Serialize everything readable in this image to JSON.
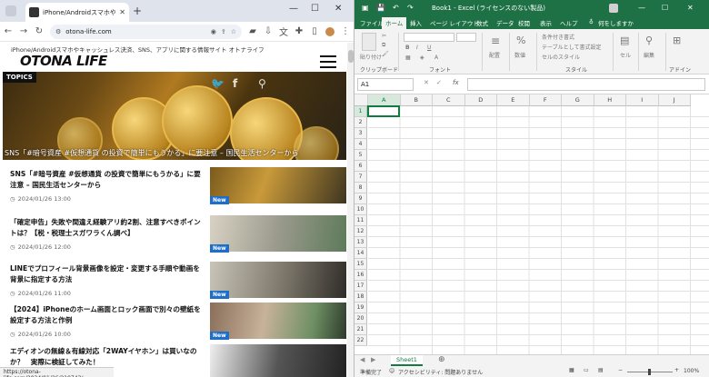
{
  "chrome": {
    "tab_title": "iPhone/Androidスマホやキャッシュ",
    "new_tab": "+",
    "url": "otona-life.com",
    "status_url": "https://otona-life.com/2024/01/26/219743/"
  },
  "site": {
    "tagline": "iPhone/Androidスマホやキャッシュレス決済、SNS、アプリに関する情報サイト オトナライフ",
    "logo": "OTONA LIFE",
    "topics_label": "TOPICS",
    "hero_caption": "SNS「#暗号資産 #仮想通貨 の投資で簡単にもうかる」に要注意 – 国民生活センターから",
    "new_badge": "New",
    "articles": [
      {
        "title": "SNS「#暗号資産 #仮想通貨 の投資で簡単にもうかる」に要注意 – 国民生活センターから",
        "date": "2024/01/26 13:00"
      },
      {
        "title": "「確定申告」失敗や間違え経験アリ約2割、注意すべきポイントは？【税・税理士スガワラくん調べ】",
        "date": "2024/01/26 12:00"
      },
      {
        "title": "LINEでプロフィール背景画像を設定・変更する手順や動画を背景に指定する方法",
        "date": "2024/01/26 11:00"
      },
      {
        "title": "【2024】iPhoneのホーム画面とロック画面で別々の壁紙を設定する方法と作例",
        "date": "2024/01/26 10:00"
      },
      {
        "title": "エディオンの無線＆有線対応「2WAYイヤホン」は買いなのか？　実際に検証してみた！",
        "date": ""
      }
    ]
  },
  "excel": {
    "title": "Book1 - Excel (ライセンスのない製品)",
    "tabs": [
      "ファイル",
      "ホーム",
      "挿入",
      "ページ レイアウト",
      "数式",
      "データ",
      "校閲",
      "表示",
      "ヘルプ",
      "何をしますか"
    ],
    "ribbon": {
      "clipboard": "クリップボード",
      "paste": "貼り付け",
      "font": "フォント",
      "align": "配置",
      "number": "数値",
      "cond_format": "条件付き書式",
      "table_format": "テーブルとして書式設定",
      "cell_styles": "セルのスタイル",
      "style": "スタイル",
      "cells": "セル",
      "editing": "編集",
      "addins": "アドイン"
    },
    "name_box": "A1",
    "fx": "fx",
    "columns": [
      "A",
      "B",
      "C",
      "D",
      "E",
      "F",
      "G",
      "H",
      "I",
      "J"
    ],
    "rows": [
      "1",
      "2",
      "3",
      "4",
      "5",
      "6",
      "7",
      "8",
      "9",
      "10",
      "11",
      "12",
      "13",
      "14",
      "15",
      "16",
      "17",
      "18",
      "19",
      "20",
      "21",
      "22"
    ],
    "sheet_tab": "Sheet1",
    "status_ready": "準備完了",
    "status_access": "アクセシビリティ: 問題ありません",
    "zoom": "100%"
  }
}
